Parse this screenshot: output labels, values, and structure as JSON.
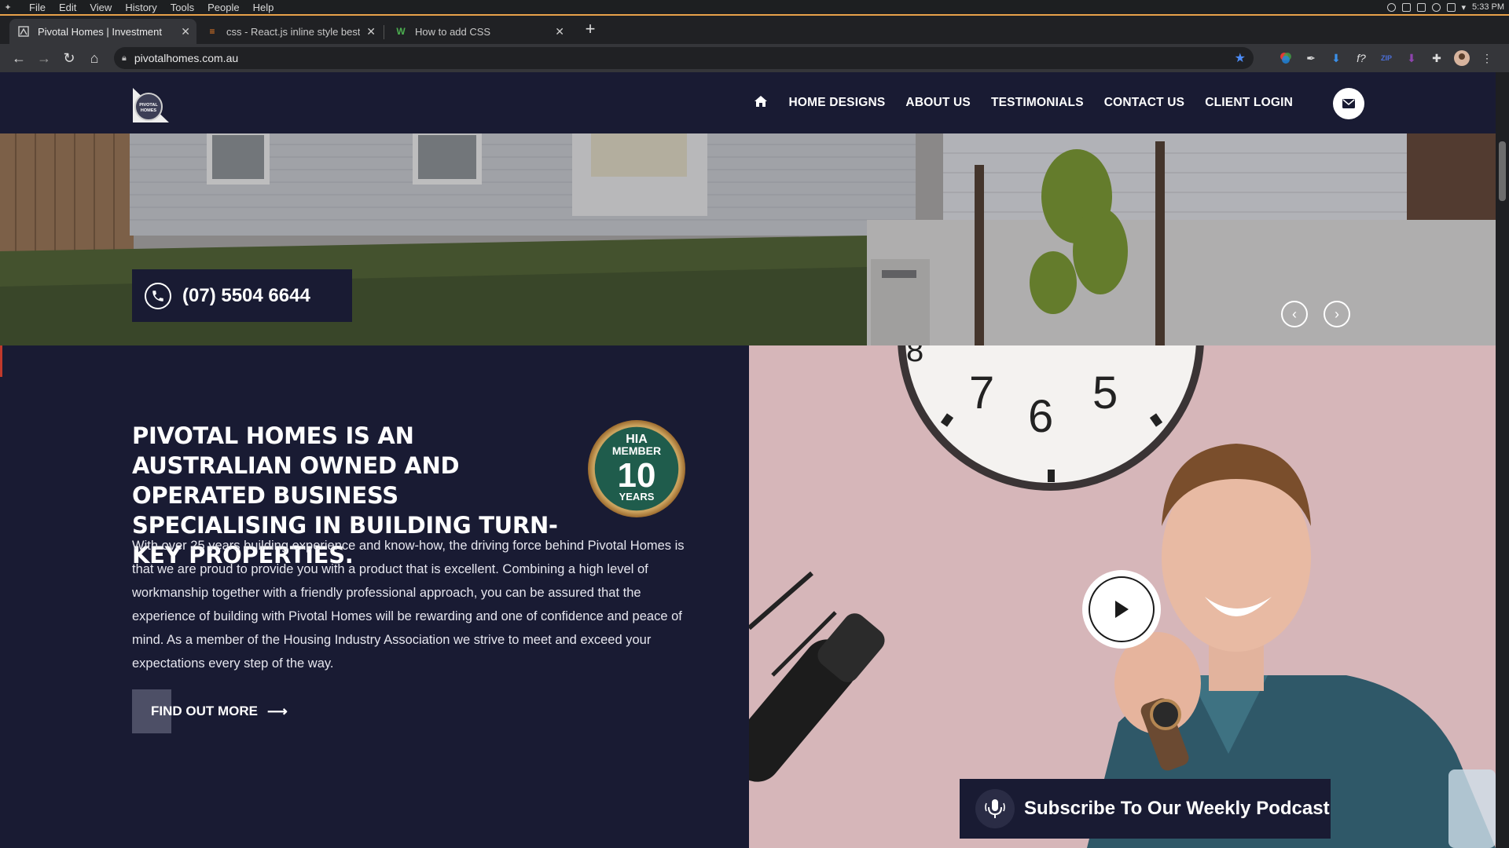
{
  "os": {
    "menu": [
      "File",
      "Edit",
      "View",
      "History",
      "Tools",
      "People",
      "Help"
    ],
    "clock": "5:33 PM"
  },
  "browser": {
    "tabs": [
      {
        "title": "Pivotal Homes | Investment",
        "active": true
      },
      {
        "title": "css - React.js inline style best",
        "active": false
      },
      {
        "title": "How to add CSS",
        "active": false
      }
    ],
    "url": "pivotalhomes.com.au"
  },
  "site": {
    "logo_text": "PIVOTAL HOMES",
    "nav": [
      "HOME DESIGNS",
      "ABOUT US",
      "TESTIMONIALS",
      "CONTACT US",
      "CLIENT LOGIN"
    ],
    "phone": "(07) 5504 6644",
    "intro": {
      "heading": "PIVOTAL HOMES IS AN AUSTRALIAN OWNED AND OPERATED BUSINESS SPECIALISING IN BUILDING TURN-KEY PROPERTIES.",
      "body": "With over 25 years building experience and know-how, the driving force behind Pivotal Homes is that we are proud to provide you with a product that is excellent. Combining a high level of workmanship together with a friendly professional approach, you can be assured that the experience of building with Pivotal Homes will be rewarding and one of confidence and peace of mind. As a member of the Housing Industry Association we strive to meet and exceed your expectations every step of the way.",
      "cta": "FIND OUT MORE"
    },
    "badge": {
      "line1": "HIA",
      "line2": "MEMBER",
      "number": "10",
      "line3": "YEARS"
    },
    "clock_numbers": [
      "7",
      "6",
      "5",
      "8"
    ],
    "podcast": "Subscribe To Our Weekly Podcast"
  },
  "colors": {
    "navy": "#191b33",
    "badge_green": "#1f5c4c",
    "badge_gold": "#b98a4a",
    "wall_pink": "#d8b9bb"
  }
}
